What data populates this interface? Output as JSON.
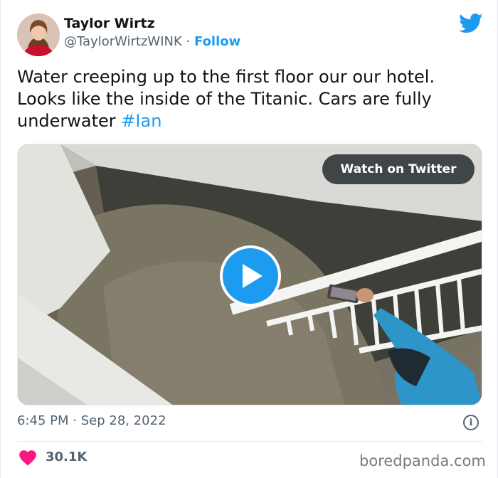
{
  "author": {
    "name": "Taylor Wirtz",
    "handle": "@TaylorWirtzWINK",
    "separator": "·",
    "follow_label": "Follow"
  },
  "tweet": {
    "text": "Water creeping up to the first floor our our hotel. Looks like the inside of the Titanic. Cars are fully underwater ",
    "hashtag": "#Ian"
  },
  "media": {
    "watch_label": "Watch on Twitter",
    "play_icon": "play-icon"
  },
  "meta": {
    "time": "6:45 PM",
    "separator": "·",
    "date": "Sep 28, 2022"
  },
  "engagement": {
    "likes": "30.1K"
  },
  "watermark": "boredpanda.com",
  "colors": {
    "accent": "#1d9bf0",
    "heart": "#f91880",
    "text": "#0f1419",
    "muted": "#536471"
  }
}
